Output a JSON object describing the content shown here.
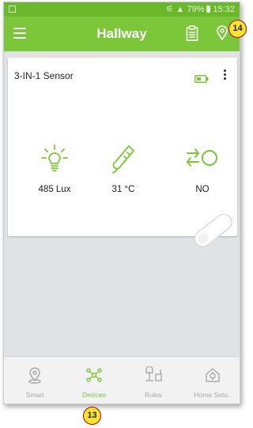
{
  "status_bar": {
    "battery": "79%",
    "time": "15:32"
  },
  "app_bar": {
    "title": "Hallway",
    "clipboard_icon": "clipboard-icon",
    "location_icon": "location-pin-icon",
    "menu_icon": "hamburger-icon"
  },
  "device_card": {
    "name": "3-IN-1 Sensor",
    "battery_icon": "battery-icon",
    "sensors": [
      {
        "icon": "lightbulb-icon",
        "value": "485 Lux"
      },
      {
        "icon": "thermometer-icon",
        "value": "31 °C"
      },
      {
        "icon": "motion-icon",
        "value": "NO"
      }
    ]
  },
  "bottom_nav": {
    "items": [
      {
        "label": "Smart",
        "icon": "smart-icon",
        "active": false
      },
      {
        "label": "Devices",
        "icon": "devices-icon",
        "active": true
      },
      {
        "label": "Rules",
        "icon": "rules-icon",
        "active": false
      },
      {
        "label": "Home Setu..",
        "icon": "home-setup-icon",
        "active": false
      }
    ]
  },
  "callouts": {
    "top": "14",
    "bottom": "13"
  },
  "colors": {
    "accent": "#7cc639",
    "status_bar": "#6ab82b",
    "callout_fill": "#ffe52e",
    "callout_border": "#c00000"
  }
}
